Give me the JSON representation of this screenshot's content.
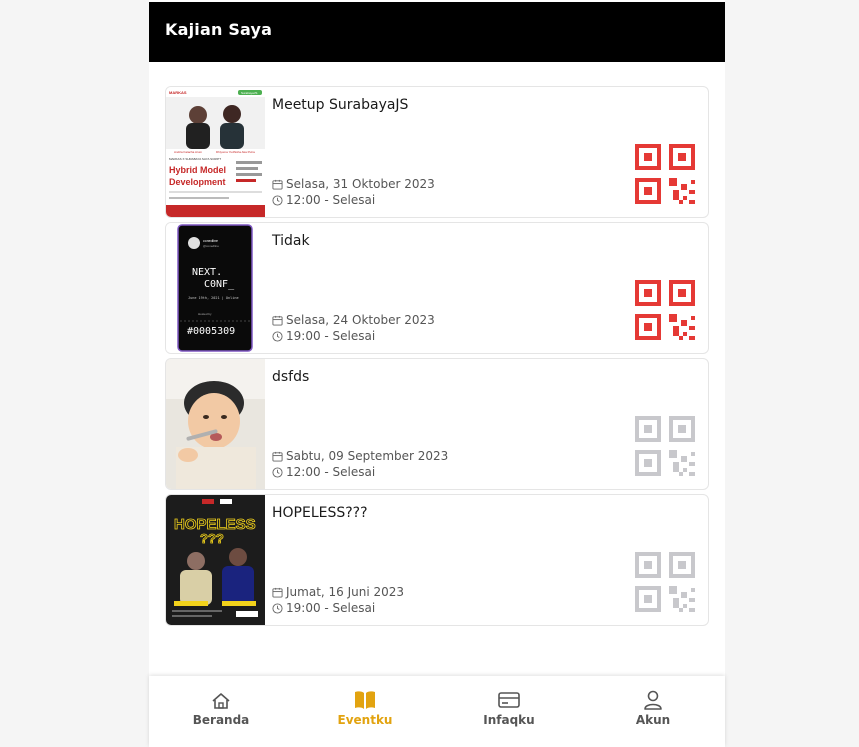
{
  "header": {
    "title": "Kajian Saya"
  },
  "events": [
    {
      "title": "Meetup SurabayaJS",
      "date": "Selasa, 31 Oktober 2023",
      "time": "12:00 - Selesai",
      "qr_status": "active",
      "qr_color": "#e53935"
    },
    {
      "title": "Tidak",
      "date": "Selasa, 24 Oktober 2023",
      "time": "19:00 - Selesai",
      "qr_status": "active",
      "qr_color": "#e53935"
    },
    {
      "title": "dsfds",
      "date": "Sabtu, 09 September 2023",
      "time": "12:00 - Selesai",
      "qr_status": "inactive",
      "qr_color": "#c8c8cc"
    },
    {
      "title": "HOPELESS???",
      "date": "Jumat, 16 Juni 2023",
      "time": "19:00 - Selesai",
      "qr_status": "inactive",
      "qr_color": "#c8c8cc"
    }
  ],
  "posters": {
    "poster1": {
      "brand": "MARKAS",
      "partner": "SurabayaJS",
      "speaker1": "Andria Fatacha Arum",
      "speaker2": "Dhiyoma Yudhisha Aka Putra",
      "event": "MARKAS X SURABAYA SAYA SCRIPT",
      "headline1": "Hybrid Model",
      "headline2": "Development"
    },
    "poster2": {
      "brand": "conedline",
      "handle": "@conedline",
      "line1": "NEXT.",
      "line2": "C0NF_",
      "date": "June 19th, 2021 | Online",
      "hosted": "Hosted by",
      "ticket": "#0005309"
    },
    "poster4": {
      "headline": "HOPELESS",
      "marks": "???"
    }
  },
  "nav": {
    "items": [
      {
        "label": "Beranda",
        "icon": "home-icon",
        "active": false
      },
      {
        "label": "Eventku",
        "icon": "book-icon",
        "active": true
      },
      {
        "label": "Infaqku",
        "icon": "card-icon",
        "active": false
      },
      {
        "label": "Akun",
        "icon": "user-icon",
        "active": false
      }
    ],
    "active_color": "#e2a310"
  }
}
